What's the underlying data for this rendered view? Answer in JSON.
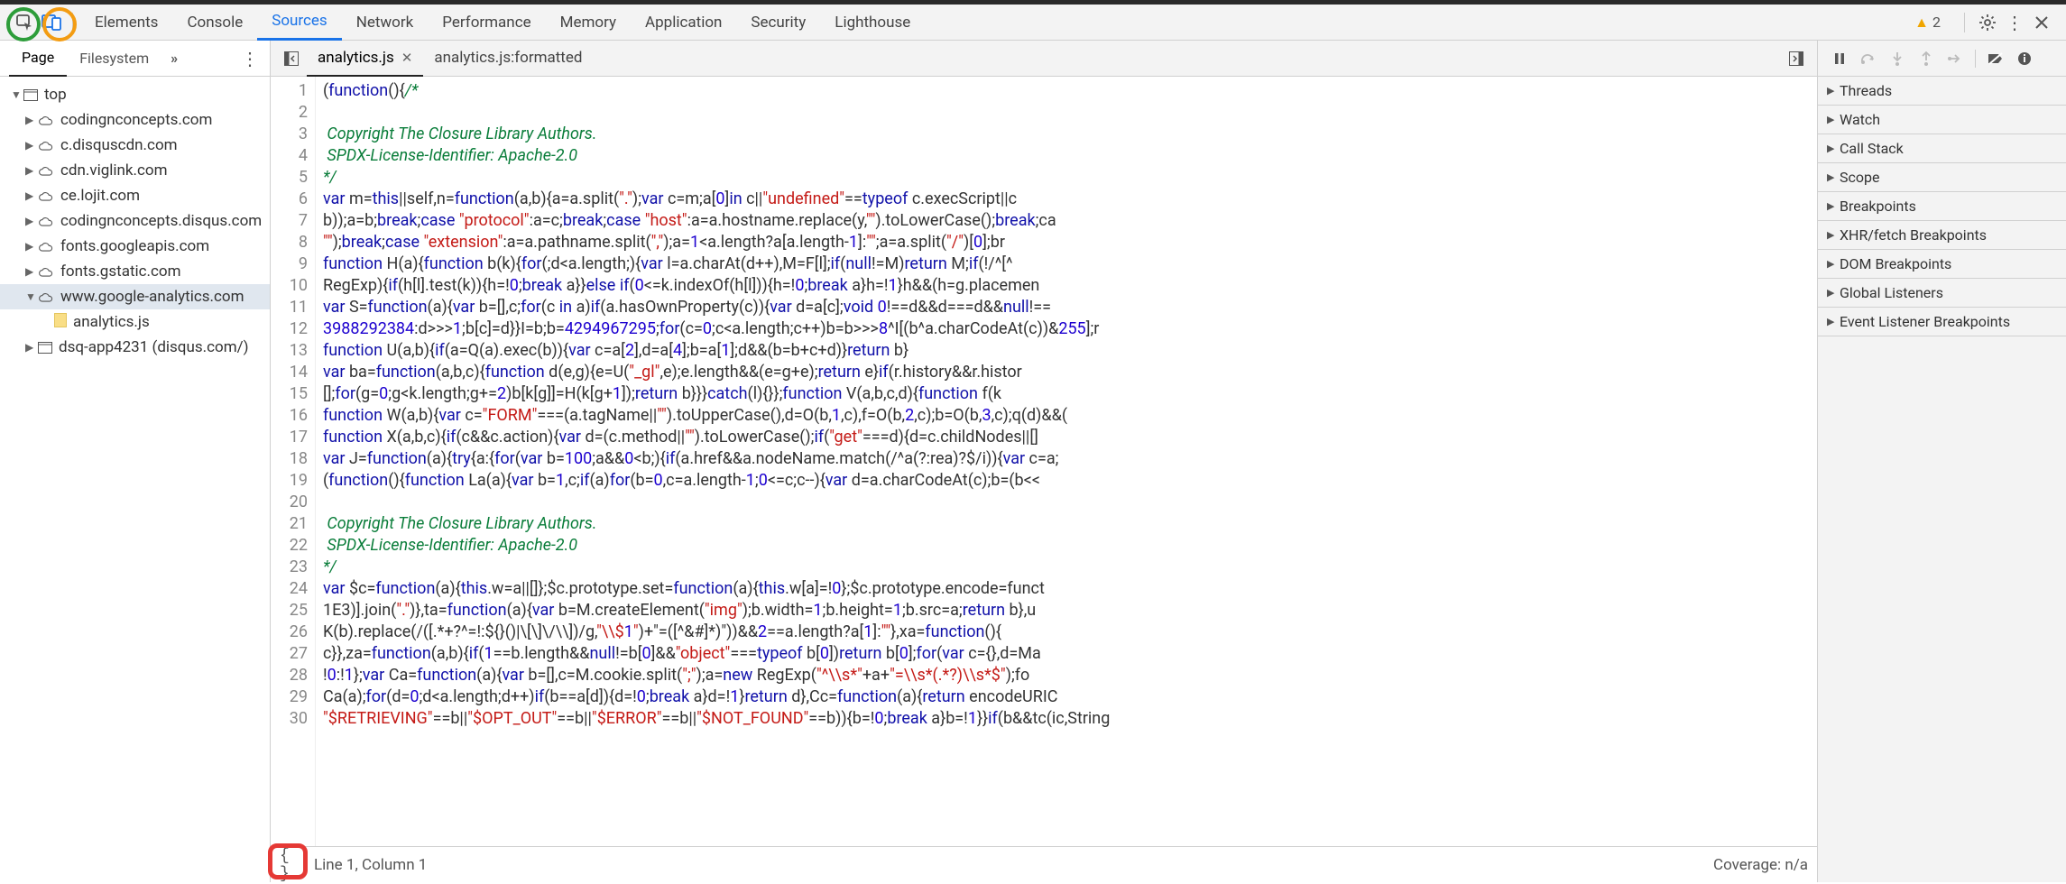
{
  "main_tabs": {
    "items": [
      "Elements",
      "Console",
      "Sources",
      "Network",
      "Performance",
      "Memory",
      "Application",
      "Security",
      "Lighthouse"
    ],
    "active": "Sources",
    "warn_count": "2"
  },
  "left": {
    "sub_tabs": {
      "page": "Page",
      "filesystem": "Filesystem"
    },
    "tree": {
      "top_label": "top",
      "domains": [
        "codingnconcepts.com",
        "c.disquscdn.com",
        "cdn.viglink.com",
        "ce.lojit.com",
        "codingnconcepts.disqus.com",
        "fonts.googleapis.com",
        "fonts.gstatic.com",
        "www.google-analytics.com"
      ],
      "selected_file": "analytics.js",
      "frame_label": "dsq-app4231 (disqus.com/)"
    }
  },
  "editor": {
    "tabs": {
      "active": "analytics.js",
      "secondary": "analytics.js:formatted"
    },
    "status": {
      "line_col": "Line 1, Column 1",
      "coverage": "Coverage: n/a",
      "format_icon": "{ }"
    },
    "lines": [
      "(function(){/*",
      "",
      " Copyright The Closure Library Authors.",
      " SPDX-License-Identifier: Apache-2.0",
      "*/",
      "var m=this||self,n=function(a,b){a=a.split(\".\");var c=m;a[0]in c||\"undefined\"==typeof c.execScript||c",
      "b));a=b;break;case \"protocol\":a=c;break;case \"host\":a=a.hostname.replace(y,\"\").toLowerCase();break;ca",
      "\"\");break;case \"extension\":a=a.pathname.split(\",\");a=1<a.length?a[a.length-1]:\"\";a=a.split(\"/\")[0];br",
      "function H(a){function b(k){for(;d<a.length;){var l=a.charAt(d++),M=F[l];if(null!=M)return M;if(!/^[^",
      "RegExp){if(h[l].test(k)){h=!0;break a}}else if(0<=k.indexOf(h[l])){h=!0;break a}h=!1}h&&(h=g.placemen",
      "var S=function(a){var b=[],c;for(c in a)if(a.hasOwnProperty(c)){var d=a[c];void 0!==d&&d===d&&null!==",
      "3988292384:d>>>1;b[c]=d}}I=b;b=4294967295;for(c=0;c<a.length;c++)b=b>>>8^I[(b^a.charCodeAt(c))&255];r",
      "function U(a,b){if(a=Q(a).exec(b)){var c=a[2],d=a[4];b=a[1];d&&(b=b+c+d)}return b}",
      "var ba=function(a,b,c){function d(e,g){e=U(\"_gl\",e);e.length&&(e=g+e);return e}if(r.history&&r.histor",
      "[];for(g=0;g<k.length;g+=2)b[k[g]]=H(k[g+1]);return b}}}catch(l){}};function V(a,b,c,d){function f(k",
      "function W(a,b){var c=\"FORM\"===(a.tagName||\"\").toUpperCase(),d=O(b,1,c),f=O(b,2,c);b=O(b,3,c);q(d)&&(",
      "function X(a,b,c){if(c&&c.action){var d=(c.method||\"\").toLowerCase();if(\"get\"===d){d=c.childNodes||[]",
      "var J=function(a){try{a:{for(var b=100;a&&0<b;){if(a.href&&a.nodeName.match(/^a(?:rea)?$/i)){var c=a;",
      "(function(){function La(a){var b=1,c;if(a)for(b=0,c=a.length-1;0<=c;c--){var d=a.charCodeAt(c);b=(b<<",
      "",
      " Copyright The Closure Library Authors.",
      " SPDX-License-Identifier: Apache-2.0",
      "*/",
      "var $c=function(a){this.w=a||[]};$c.prototype.set=function(a){this.w[a]=!0};$c.prototype.encode=funct",
      "1E3)].join(\".\")},ta=function(a){var b=M.createElement(\"img\");b.width=1;b.height=1;b.src=a;return b},u",
      "K(b).replace(/([.*+?^=!:${}()|\\[\\]\\/\\\\])/g,\"\\\\$1\")+\"=([^&#]*)\"))&&2==a.length?a[1]:\"\"},xa=function(){",
      "c}},za=function(a,b){if(1==b.length&&null!=b[0]&&\"object\"===typeof b[0])return b[0];for(var c={},d=Ma",
      "!0:!1};var Ca=function(a){var b=[],c=M.cookie.split(\";\");a=new RegExp(\"^\\\\s*\"+a+\"=\\\\s*(.*?)\\\\s*$\");fo",
      "Ca(a);for(d=0;d<a.length;d++)if(b==a[d]){d=!0;break a}d=!1}return d},Cc=function(a){return encodeURIC",
      "\"$RETRIEVING\"==b||\"$OPT_OUT\"==b||\"$ERROR\"==b||\"$NOT_FOUND\"==b)){b=!0;break a}b=!1}}if(b&&tc(ic,String"
    ]
  },
  "debug_sections": [
    "Threads",
    "Watch",
    "Call Stack",
    "Scope",
    "Breakpoints",
    "XHR/fetch Breakpoints",
    "DOM Breakpoints",
    "Global Listeners",
    "Event Listener Breakpoints"
  ]
}
